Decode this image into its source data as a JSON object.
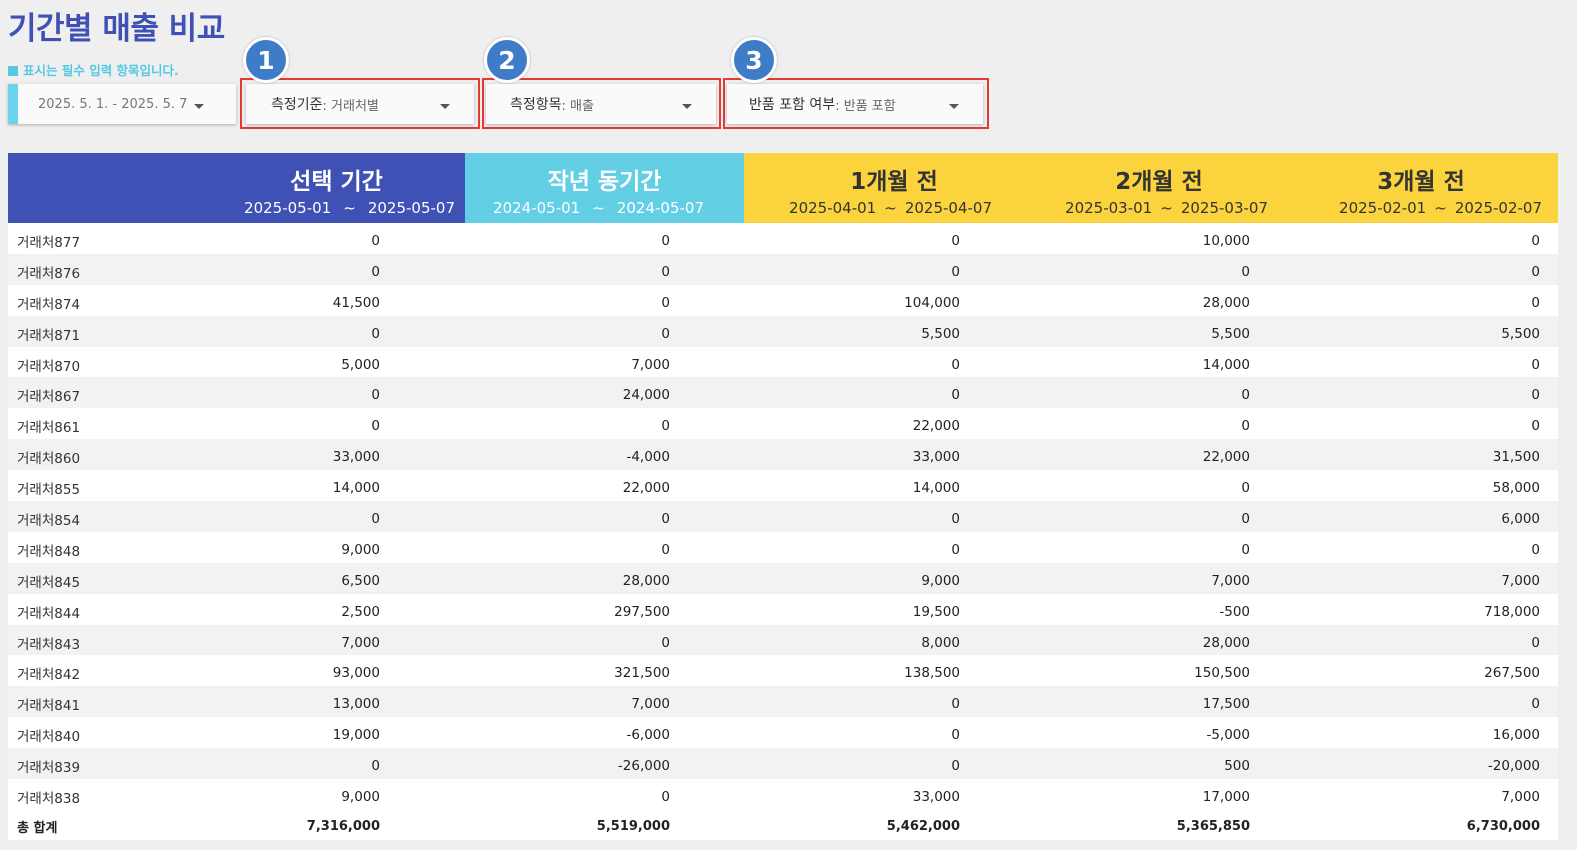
{
  "title": "기간별 매출 비교",
  "required_note": "표시는 필수 입력 항목입니다.",
  "date_range": "2025. 5. 1. - 2025. 5. 7",
  "controls": [
    {
      "badge": "1",
      "label": "측정기준",
      "value": ": 거래처별"
    },
    {
      "badge": "2",
      "label": "측정항목",
      "value": ": 매출"
    },
    {
      "badge": "3",
      "label": "반품 포함 여부",
      "value": ": 반품 포함"
    }
  ],
  "colors": {
    "primary": "#3f51b5",
    "cyan": "#62cfe4",
    "yellow": "#fbd43d",
    "highlight": "#e53935",
    "badge": "#3f7cc7"
  },
  "headers": [
    {
      "title": "선택 기간",
      "start": "2025-05-01",
      "sep": "~",
      "end": "2025-05-07"
    },
    {
      "title": "작년 동기간",
      "start": "2024-05-01",
      "sep": "~",
      "end": "2024-05-07"
    },
    {
      "title": "1개월 전",
      "start": "2025-04-01",
      "sep": "~",
      "end": "2025-04-07"
    },
    {
      "title": "2개월 전",
      "start": "2025-03-01",
      "sep": "~",
      "end": "2025-03-07"
    },
    {
      "title": "3개월 전",
      "start": "2025-02-01",
      "sep": "~",
      "end": "2025-02-07"
    }
  ],
  "rows": [
    {
      "name": "거래처877",
      "v": [
        "0",
        "0",
        "0",
        "10,000",
        "0"
      ]
    },
    {
      "name": "거래처876",
      "v": [
        "0",
        "0",
        "0",
        "0",
        "0"
      ]
    },
    {
      "name": "거래처874",
      "v": [
        "41,500",
        "0",
        "104,000",
        "28,000",
        "0"
      ]
    },
    {
      "name": "거래처871",
      "v": [
        "0",
        "0",
        "5,500",
        "5,500",
        "5,500"
      ]
    },
    {
      "name": "거래처870",
      "v": [
        "5,000",
        "7,000",
        "0",
        "14,000",
        "0"
      ]
    },
    {
      "name": "거래처867",
      "v": [
        "0",
        "24,000",
        "0",
        "0",
        "0"
      ]
    },
    {
      "name": "거래처861",
      "v": [
        "0",
        "0",
        "22,000",
        "0",
        "0"
      ]
    },
    {
      "name": "거래처860",
      "v": [
        "33,000",
        "-4,000",
        "33,000",
        "22,000",
        "31,500"
      ]
    },
    {
      "name": "거래처855",
      "v": [
        "14,000",
        "22,000",
        "14,000",
        "0",
        "58,000"
      ]
    },
    {
      "name": "거래처854",
      "v": [
        "0",
        "0",
        "0",
        "0",
        "6,000"
      ]
    },
    {
      "name": "거래처848",
      "v": [
        "9,000",
        "0",
        "0",
        "0",
        "0"
      ]
    },
    {
      "name": "거래처845",
      "v": [
        "6,500",
        "28,000",
        "9,000",
        "7,000",
        "7,000"
      ]
    },
    {
      "name": "거래처844",
      "v": [
        "2,500",
        "297,500",
        "19,500",
        "-500",
        "718,000"
      ]
    },
    {
      "name": "거래처843",
      "v": [
        "7,000",
        "0",
        "8,000",
        "28,000",
        "0"
      ]
    },
    {
      "name": "거래처842",
      "v": [
        "93,000",
        "321,500",
        "138,500",
        "150,500",
        "267,500"
      ]
    },
    {
      "name": "거래처841",
      "v": [
        "13,000",
        "7,000",
        "0",
        "17,500",
        "0"
      ]
    },
    {
      "name": "거래처840",
      "v": [
        "19,000",
        "-6,000",
        "0",
        "-5,000",
        "16,000"
      ]
    },
    {
      "name": "거래처839",
      "v": [
        "0",
        "-26,000",
        "0",
        "500",
        "-20,000"
      ]
    },
    {
      "name": "거래처838",
      "v": [
        "9,000",
        "0",
        "33,000",
        "17,000",
        "7,000"
      ]
    }
  ],
  "total": {
    "name": "총 합계",
    "v": [
      "7,316,000",
      "5,519,000",
      "5,462,000",
      "5,365,850",
      "6,730,000"
    ]
  }
}
